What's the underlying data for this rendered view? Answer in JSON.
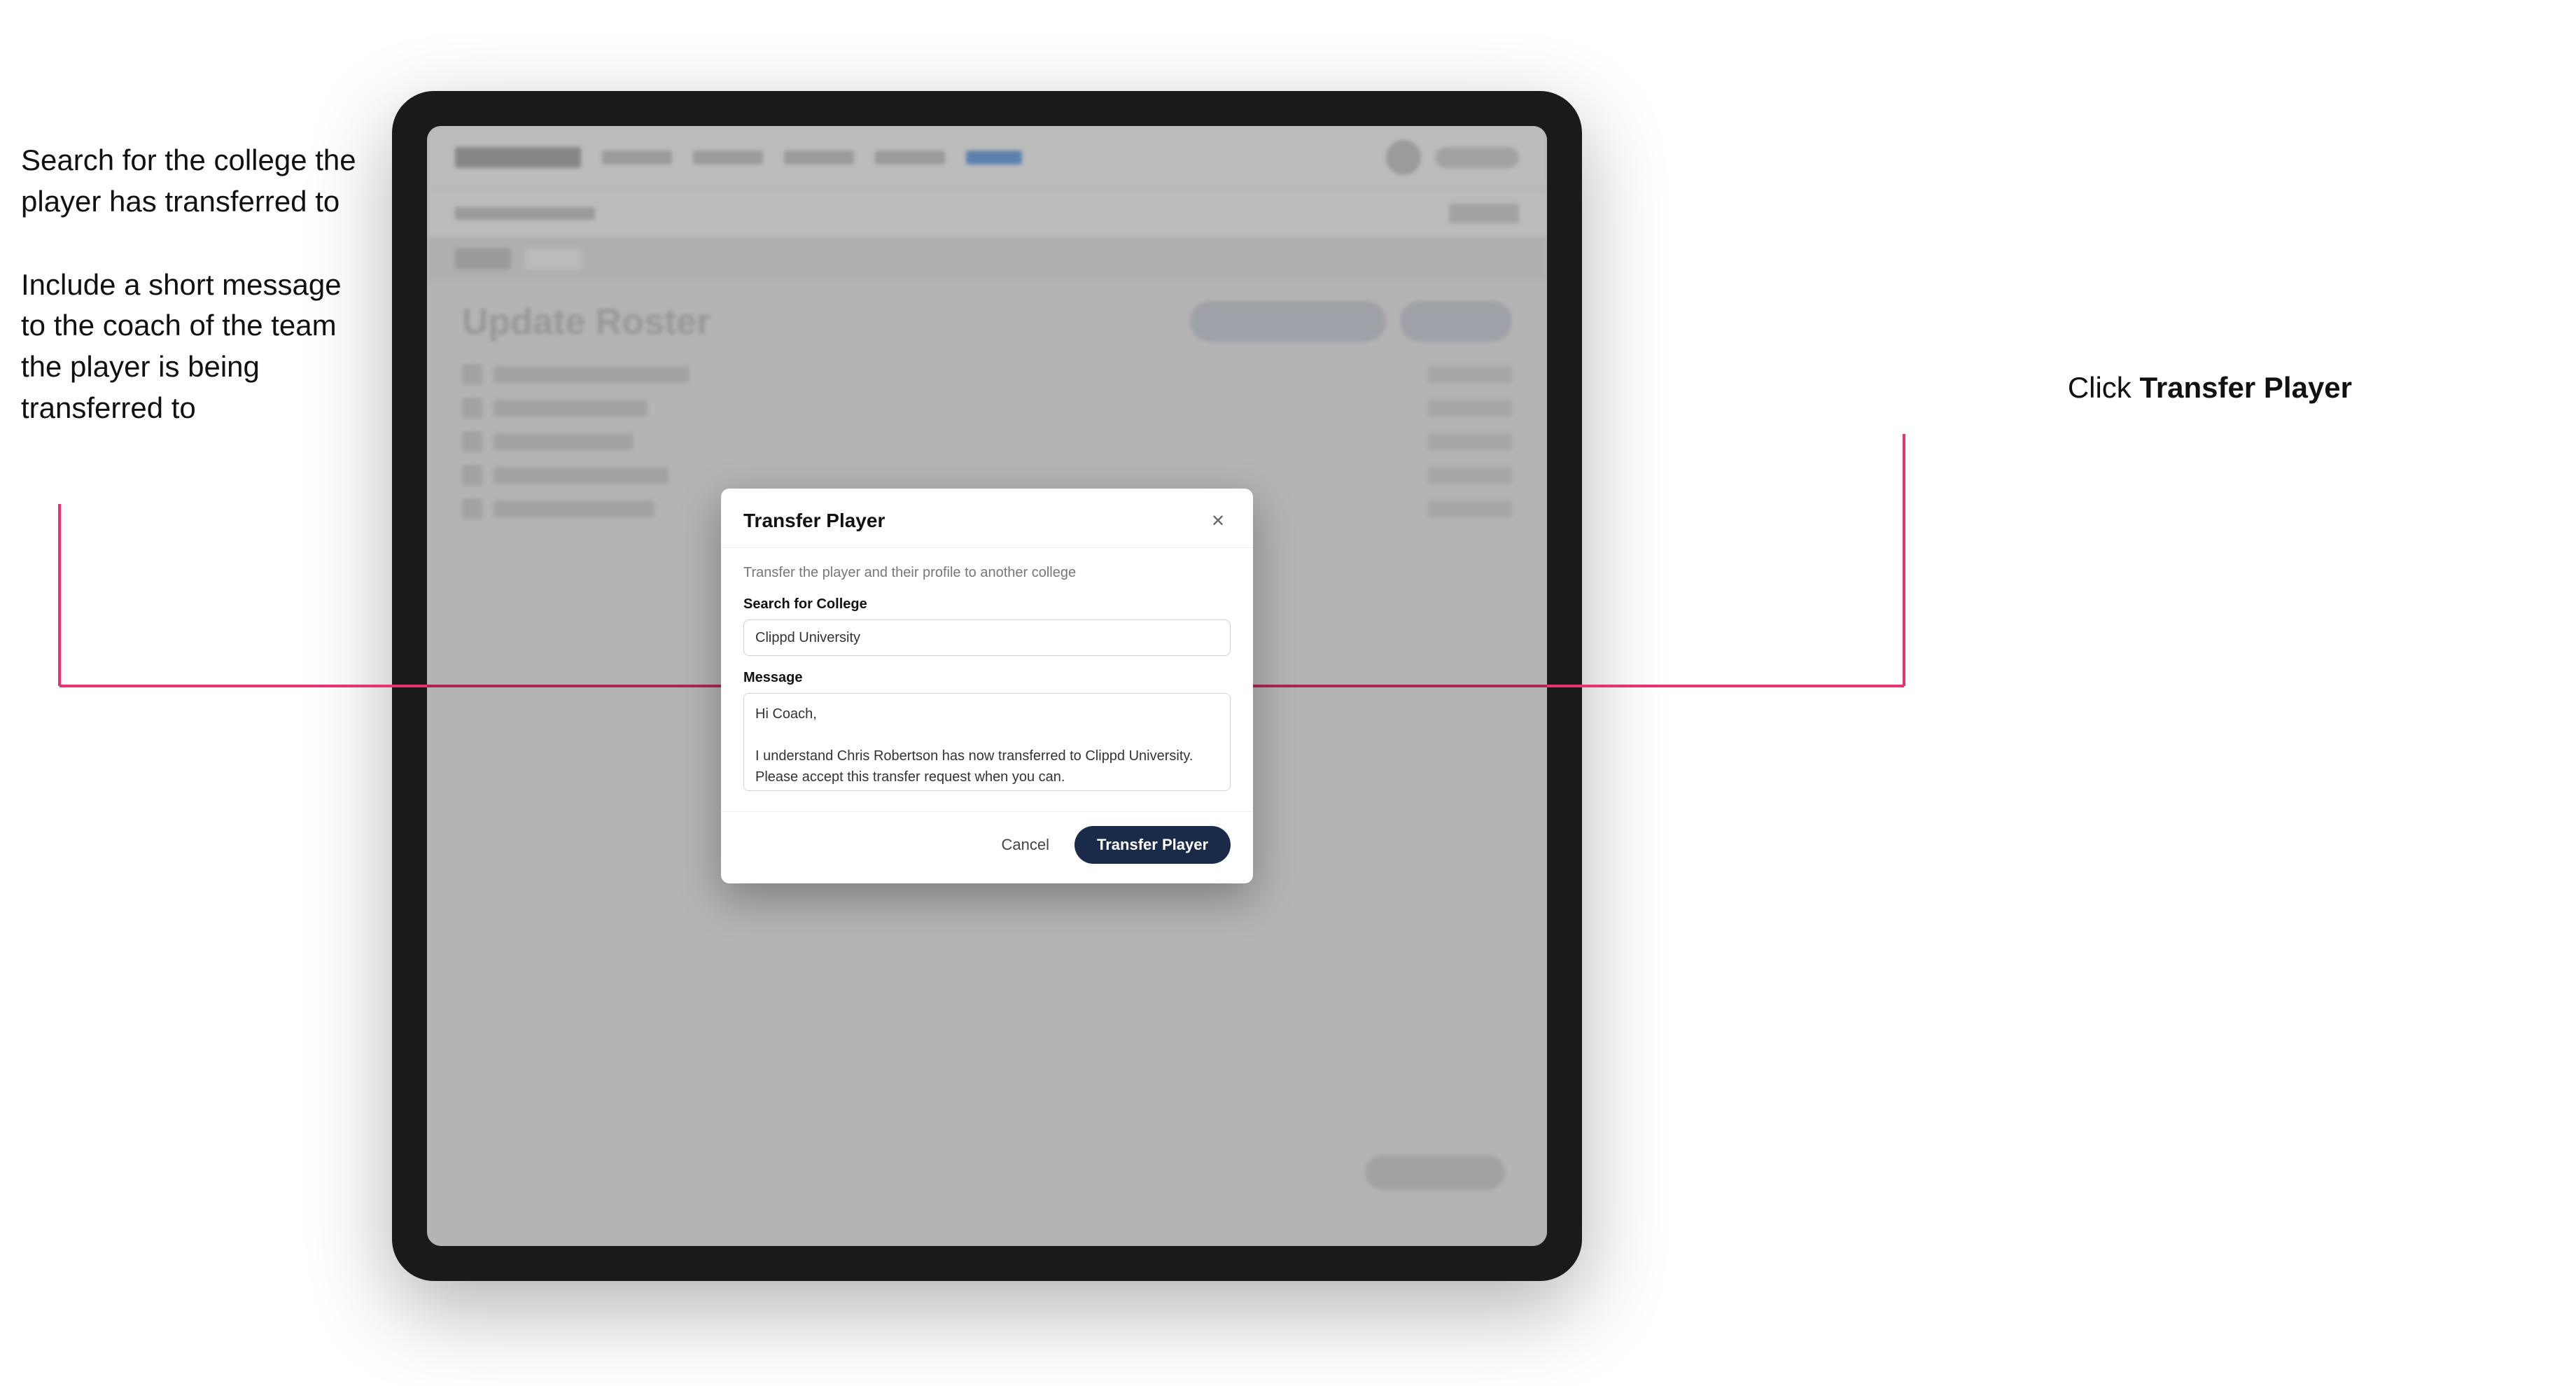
{
  "annotations": {
    "left_top": "Search for the college the player has transferred to",
    "left_bottom": "Include a short message\nto the coach of the team\nthe player is being\ntransferred to",
    "right": "Click Transfer Player"
  },
  "dialog": {
    "title": "Transfer Player",
    "subtitle": "Transfer the player and their profile to another college",
    "search_label": "Search for College",
    "search_value": "Clippd University",
    "message_label": "Message",
    "message_value": "Hi Coach,\n\nI understand Chris Robertson has now transferred to Clippd University. Please accept this transfer request when you can.",
    "cancel_label": "Cancel",
    "transfer_label": "Transfer Player"
  },
  "bg": {
    "page_title": "Update Roster"
  }
}
